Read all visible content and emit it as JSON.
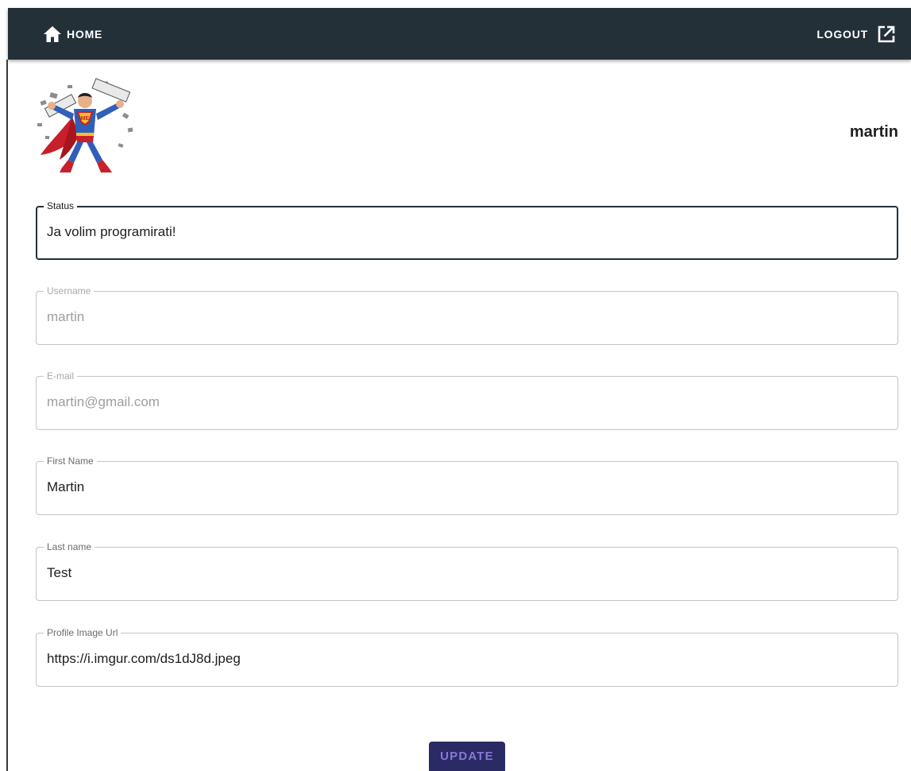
{
  "nav": {
    "home_label": "HOME",
    "home_icon": "home-icon",
    "logout_label": "LOGOUT",
    "logout_icon": "open-in-new-icon",
    "bar_color": "#243038"
  },
  "profile": {
    "username_heading": "martin",
    "avatar_icon": "superman-avatar"
  },
  "form": {
    "status": {
      "label": "Status",
      "value": "Ja volim programirati!"
    },
    "username": {
      "label": "Username",
      "value": "martin"
    },
    "email": {
      "label": "E-mail",
      "value": "martin@gmail.com"
    },
    "first_name": {
      "label": "First Name",
      "value": "Martin"
    },
    "last_name": {
      "label": "Last name",
      "value": "Test"
    },
    "profile_image_url": {
      "label": "Profile Image Url",
      "value": "https://i.imgur.com/ds1dJ8d.jpeg"
    }
  },
  "actions": {
    "update_label": "UPDATE",
    "update_color": "#2a2a64"
  }
}
